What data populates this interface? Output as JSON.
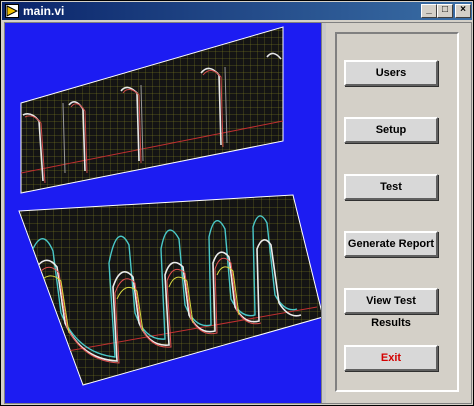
{
  "window": {
    "title": "main.vi",
    "controls": {
      "minimize": "_",
      "maximize": "□",
      "close": "×"
    }
  },
  "icons": {
    "app": "labview-vi-icon"
  },
  "colors": {
    "graph_background": "#1c1cf2",
    "exit_label": "#d40000",
    "titlebar": "#0a246a"
  },
  "menu": {
    "users": "Users",
    "setup": "Setup",
    "test": "Test",
    "generate_report": "Generate Report",
    "view_test_results": "View Test Results",
    "exit": "Exit"
  }
}
